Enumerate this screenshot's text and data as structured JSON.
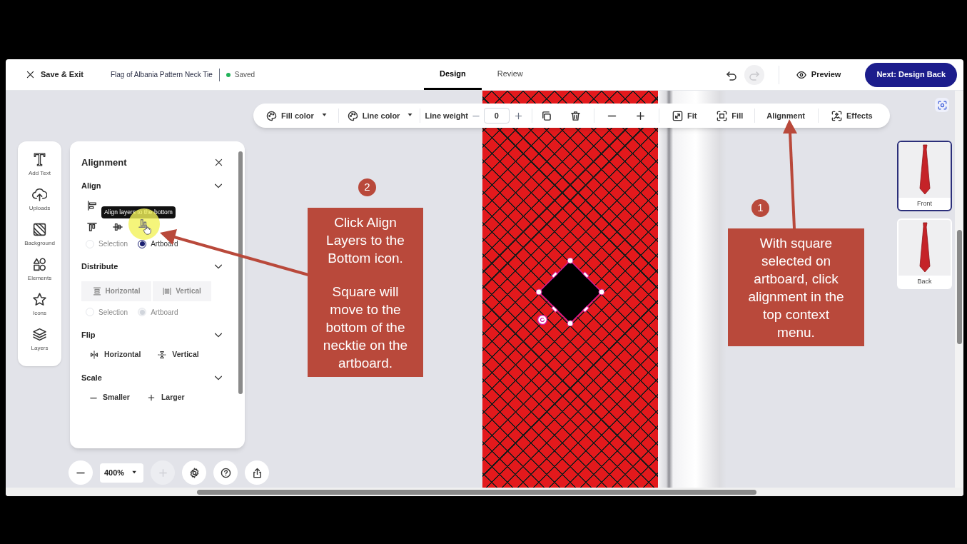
{
  "header": {
    "exit_button": "Save & Exit",
    "document_title": "Flag of Albania Pattern Neck Tie",
    "save_status": "Saved",
    "tabs": [
      {
        "label": "Design",
        "selected": true
      },
      {
        "label": "Review",
        "selected": false
      }
    ],
    "redo_disabled": true,
    "preview_button": "Preview",
    "next_button": "Next: Design Back"
  },
  "context_toolbar": {
    "fill_color": "Fill color",
    "line_color": "Line color",
    "line_weight": {
      "label": "Line weight",
      "value": "0"
    },
    "fit": "Fit",
    "fill": "Fill",
    "alignment": "Alignment",
    "effects": "Effects"
  },
  "sidebar": [
    "Add Text",
    "Uploads",
    "Background",
    "Elements",
    "Icons",
    "Layers"
  ],
  "alignment_panel": {
    "title": "Alignment",
    "sections": [
      {
        "kind": "align",
        "title": "Align",
        "expanded": true,
        "disabled": false,
        "tooltip": "Align layers to the bottom",
        "reference": [
          {
            "label": "Selection",
            "selected": false
          },
          {
            "label": "Artboard",
            "selected": true
          }
        ]
      },
      {
        "kind": "distribute",
        "title": "Distribute",
        "expanded": true,
        "disabled": true,
        "buttons": [
          "Horizontal",
          "Vertical"
        ],
        "reference": [
          {
            "label": "Selection",
            "selected": false
          },
          {
            "label": "Artboard",
            "selected": true
          }
        ]
      },
      {
        "kind": "flip",
        "title": "Flip",
        "expanded": true,
        "disabled": false,
        "buttons": [
          "Horizontal",
          "Vertical"
        ]
      },
      {
        "kind": "scale",
        "title": "Scale",
        "expanded": true,
        "disabled": false,
        "buttons": [
          "Smaller",
          "Larger"
        ]
      }
    ]
  },
  "zoom": {
    "value": "400%",
    "zoom_in_disabled": true
  },
  "pages": [
    {
      "label": "Front",
      "selected": true
    },
    {
      "label": "Back",
      "selected": false
    }
  ],
  "annotations": [
    {
      "number": "2",
      "paragraphs": [
        "Click Align Layers to the Bottom icon.",
        "Square will move to the bottom of the necktie on the artboard."
      ]
    },
    {
      "number": "1",
      "paragraphs": [
        "With square selected on artboard, click alignment in the top context menu."
      ]
    }
  ]
}
